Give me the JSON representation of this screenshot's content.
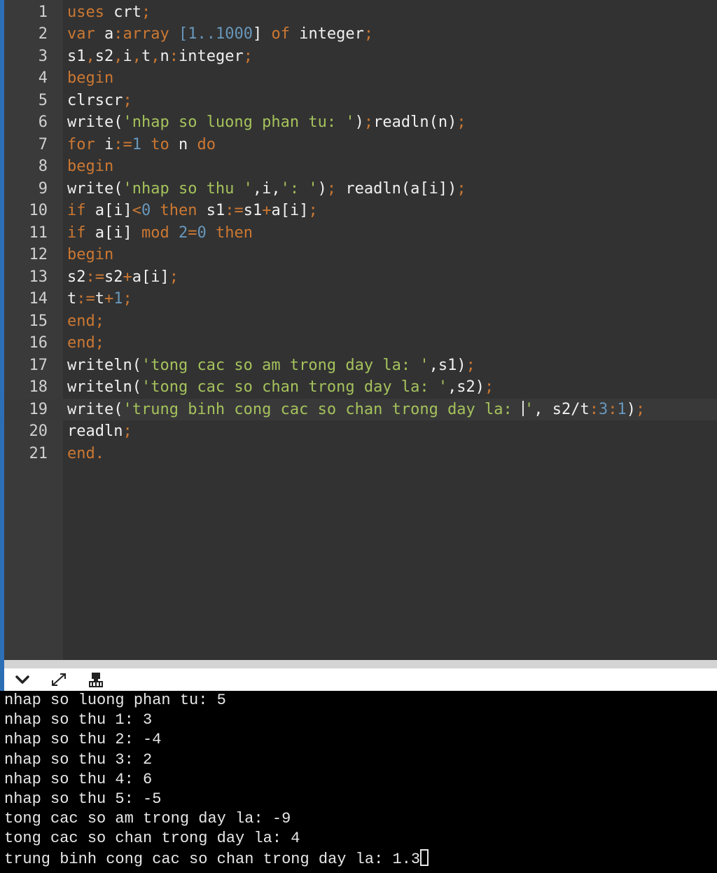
{
  "editor": {
    "line_numbers": [
      "1",
      "2",
      "3",
      "4",
      "5",
      "6",
      "7",
      "8",
      "9",
      "10",
      "11",
      "12",
      "13",
      "14",
      "15",
      "16",
      "17",
      "18",
      "19",
      "20",
      "21"
    ],
    "current_line": 19
  },
  "console": {
    "lines": [
      "nhap so luong phan tu: 5",
      "nhap so thu 1: 3",
      "nhap so thu 2: -4",
      "nhap so thu 3: 2",
      "nhap so thu 4: 6",
      "nhap so thu 5: -5",
      "tong cac so am trong day la: -9",
      "tong cac so chan trong day la: 4",
      "trung binh cong cac so chan trong day la: 1.3"
    ]
  },
  "toolbar": {
    "icons": [
      "chevron-down-icon",
      "expand-icon",
      "clear-console-icon"
    ]
  },
  "colors": {
    "keyword": "#cc7832",
    "number": "#6897bb",
    "string": "#a5c25c",
    "text": "#f0f0f0",
    "editor_bg": "#323232",
    "console_bg": "#000000"
  }
}
